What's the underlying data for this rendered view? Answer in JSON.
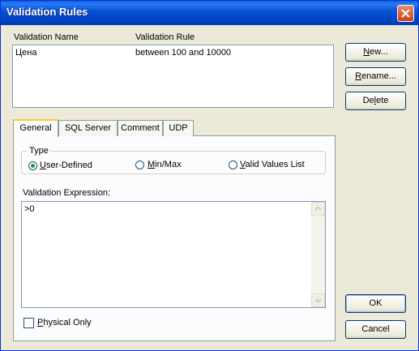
{
  "window": {
    "title": "Validation Rules"
  },
  "list": {
    "headers": [
      "Validation Name",
      "Validation Rule"
    ],
    "rows": [
      {
        "name": "Цена",
        "rule": "between 100 and 10000"
      }
    ]
  },
  "side_buttons": {
    "new": {
      "pre": "",
      "mnemonic": "N",
      "post": "ew..."
    },
    "rename": {
      "pre": "",
      "mnemonic": "R",
      "post": "ename..."
    },
    "delete": {
      "pre": "De",
      "mnemonic": "l",
      "post": "ete"
    }
  },
  "tabs": [
    {
      "label": "General",
      "active": true
    },
    {
      "label": "SQL Server",
      "active": false
    },
    {
      "label": "Comment",
      "active": false
    },
    {
      "label": "UDP",
      "active": false
    }
  ],
  "type_group": {
    "title": "Type",
    "options": [
      {
        "pre": "",
        "mnemonic": "U",
        "post": "ser-Defined",
        "selected": true
      },
      {
        "pre": "",
        "mnemonic": "M",
        "post": "in/Max",
        "selected": false
      },
      {
        "pre": "",
        "mnemonic": "V",
        "post": "alid Values List",
        "selected": false
      }
    ]
  },
  "expression": {
    "label": "Validation Expression:",
    "value": ">0"
  },
  "physical_only": {
    "pre": "",
    "mnemonic": "P",
    "post": "hysical Only",
    "checked": false
  },
  "footer_buttons": {
    "ok": "OK",
    "cancel": "Cancel"
  },
  "colors": {
    "title_bar": "#0054e3",
    "dialog_bg": "#ece9d8",
    "close_button": "#c74219",
    "radio_dot": "#21a121"
  }
}
